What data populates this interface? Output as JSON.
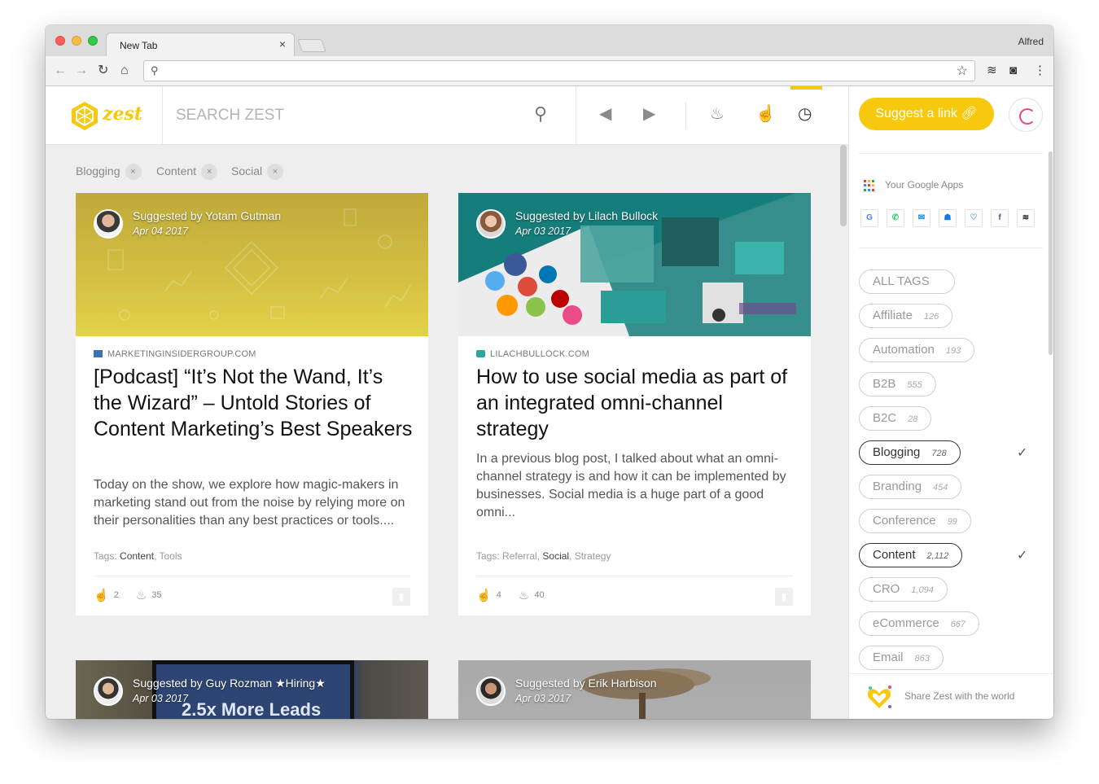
{
  "browser": {
    "tab_title": "New Tab",
    "tab_close": "×",
    "profile_name": "Alfred",
    "address_value": ""
  },
  "header": {
    "logo_text": "zest",
    "search_placeholder": "SEARCH ZEST",
    "active_view": "recent"
  },
  "filters": [
    {
      "label": "Blogging",
      "remove": "×"
    },
    {
      "label": "Content",
      "remove": "×"
    },
    {
      "label": "Social",
      "remove": "×"
    }
  ],
  "cards": [
    {
      "suggested_by": "Suggested by Yotam Gutman",
      "date": "Apr 04 2017",
      "source": "MARKETINGINSIDERGROUP.COM",
      "title": "[Podcast] “It’s Not the Wand, It’s the Wizard” – Untold Stories of Content Marketing’s Best Speakers",
      "description": "Today on the show, we explore how magic-makers in marketing stand out from the noise by relying more on their personalities than any best practices or tools....",
      "tags_label": "Tags:",
      "tags": [
        "Content",
        "Tools"
      ],
      "clicks": "2",
      "hot": "35"
    },
    {
      "suggested_by": "Suggested by Lilach Bullock",
      "date": "Apr 03 2017",
      "source": "LILACHBULLOCK.COM",
      "title": "How to use social media as part of an integrated omni-channel strategy",
      "description": "In a previous blog post, I talked about what an omni-channel strategy is and how it can be implemented by businesses. Social media is a huge part of a good omni...",
      "tags_label": "Tags:",
      "tags": [
        "Referral",
        "Social",
        "Strategy"
      ],
      "clicks": "4",
      "hot": "40"
    },
    {
      "suggested_by": "Suggested by Guy Rozman ★Hiring★",
      "date": "Apr 03 2017",
      "hero_text": "2.5x More Leads"
    },
    {
      "suggested_by": "Suggested by Erik Harbison",
      "date": "Apr 03 2017"
    }
  ],
  "sidebar": {
    "suggest_button": "Suggest a link",
    "google_apps_label": "Your Google Apps",
    "apps": [
      {
        "name": "google",
        "glyph": "G",
        "color": "#4285f4"
      },
      {
        "name": "whatsapp",
        "glyph": "✆",
        "color": "#25d366"
      },
      {
        "name": "messenger",
        "glyph": "✉",
        "color": "#0084ff"
      },
      {
        "name": "contacts",
        "glyph": "☗",
        "color": "#1a73e8"
      },
      {
        "name": "chat",
        "glyph": "♡",
        "color": "#5aa0e8"
      },
      {
        "name": "facebook",
        "glyph": "f",
        "color": "#3b5998"
      },
      {
        "name": "buffer",
        "glyph": "≋",
        "color": "#222222"
      }
    ],
    "all_tags": "ALL TAGS",
    "tags": [
      {
        "name": "Affiliate",
        "count": "126",
        "active": false
      },
      {
        "name": "Automation",
        "count": "193",
        "active": false
      },
      {
        "name": "B2B",
        "count": "555",
        "active": false
      },
      {
        "name": "B2C",
        "count": "28",
        "active": false
      },
      {
        "name": "Blogging",
        "count": "728",
        "active": true
      },
      {
        "name": "Branding",
        "count": "454",
        "active": false
      },
      {
        "name": "Conference",
        "count": "99",
        "active": false
      },
      {
        "name": "Content",
        "count": "2,112",
        "active": true
      },
      {
        "name": "CRO",
        "count": "1,094",
        "active": false
      },
      {
        "name": "eCommerce",
        "count": "667",
        "active": false
      },
      {
        "name": "Email",
        "count": "863",
        "active": false
      }
    ],
    "check_glyph": "✓",
    "share_text": "Share Zest with the world"
  },
  "colors": {
    "brand_yellow": "#f6c90e",
    "text_dark": "#111111",
    "muted": "#888888"
  }
}
